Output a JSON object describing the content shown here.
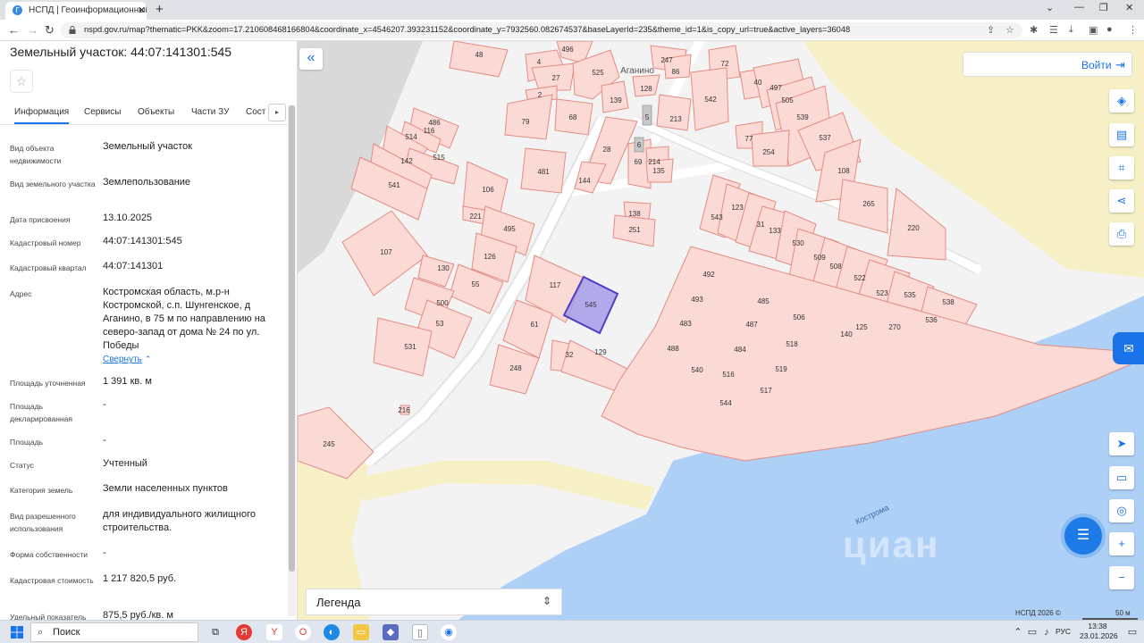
{
  "browser": {
    "tab_title": "НСПД | Геоинформационный п",
    "url": "nspd.gov.ru/map?thematic=PKK&zoom=17.210608468166804&coordinate_x=4546207.393231152&coordinate_y=7932560.082674537&baseLayerId=235&theme_id=1&is_copy_url=true&active_layers=36048"
  },
  "panel": {
    "title": "Земельный участок: 44:07:141301:545",
    "tabs": [
      "Информация",
      "Сервисы",
      "Объекты",
      "Части ЗУ",
      "Сост"
    ],
    "rows": [
      {
        "label": "Вид объекта недвижимости",
        "value": "Земельный участок"
      },
      {
        "label": "Вид земельного участка",
        "value": "Землепользование"
      },
      {
        "label": "Дата присвоения",
        "value": "13.10.2025"
      },
      {
        "label": "Кадастровый номер",
        "value": "44:07:141301:545"
      },
      {
        "label": "Кадастровый квартал",
        "value": "44:07:141301"
      },
      {
        "label": "Адрес",
        "value": "Костромская область, м.р-н Костромской, с.п. Шунгенское, д Аганино, в 75 м по направлению на северо-запад от дома № 24 по ул. Победы"
      },
      {
        "label": "Площадь уточненная",
        "value": "1 391 кв. м"
      },
      {
        "label": "Площадь декларированная",
        "value": "-"
      },
      {
        "label": "Площадь",
        "value": "-"
      },
      {
        "label": "Статус",
        "value": "Учтенный"
      },
      {
        "label": "Категория земель",
        "value": "Земли населенных пунктов"
      },
      {
        "label": "Вид разрешенного использования",
        "value": "для индивидуального жилищного строительства."
      },
      {
        "label": "Форма собственности",
        "value": "-"
      },
      {
        "label": "Кадастровая стоимость",
        "value": "1 217 820,5 руб."
      },
      {
        "label": "Удельный показатель",
        "value": "875,5 руб./кв. м"
      }
    ],
    "collapse_link": "Свернуть"
  },
  "map": {
    "login_label": "Войти",
    "legend_label": "Легенда",
    "copyright": "НСПД 2026 ©",
    "scale_label": "50 м",
    "village_label": "Аганино",
    "river_label": "Кострома",
    "watermark": "циан",
    "selected_parcel": "545",
    "parcel_labels": [
      "48",
      "4",
      "496",
      "27",
      "525",
      "247",
      "86",
      "72",
      "40",
      "497",
      "505",
      "539",
      "537",
      "2",
      "79",
      "68",
      "139",
      "128",
      "5",
      "213",
      "542",
      "77",
      "254",
      "108",
      "486",
      "116",
      "514",
      "515",
      "142",
      "28",
      "6",
      "69",
      "214",
      "135",
      "481",
      "144",
      "541",
      "106",
      "221",
      "495",
      "138",
      "251",
      "543",
      "123",
      "31",
      "133",
      "530",
      "265",
      "220",
      "107",
      "130",
      "126",
      "55",
      "117",
      "492",
      "509",
      "508",
      "522",
      "523",
      "535",
      "538",
      "500",
      "53",
      "531",
      "61",
      "493",
      "485",
      "506",
      "125",
      "270",
      "536",
      "483",
      "487",
      "140",
      "32",
      "129",
      "488",
      "484",
      "518",
      "248",
      "540",
      "516",
      "519",
      "517",
      "544",
      "216",
      "245"
    ],
    "colors": {
      "parcel_fill": "#fbdad6",
      "parcel_stroke": "#e38b82",
      "selected_fill": "#a59be6",
      "selected_stroke": "#4b3fc4",
      "water": "#a8cdf5",
      "road_yellow": "#f6efc4"
    }
  },
  "taskbar": {
    "search_label": "Поиск",
    "lang": "РУС",
    "time": "13:38",
    "date": "23.01.2026"
  }
}
